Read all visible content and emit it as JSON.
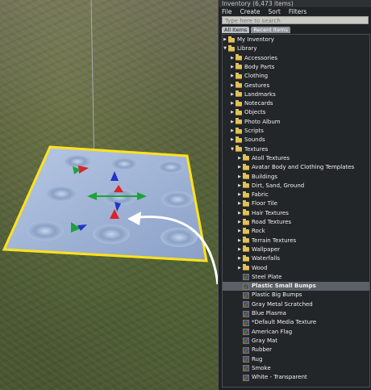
{
  "panel": {
    "title": "Inventory (6,473 items)",
    "menu": [
      "File",
      "Create",
      "Sort",
      "Filters"
    ],
    "search_placeholder": "Type here to search",
    "tabs": [
      "All Items",
      "Recent Items"
    ]
  },
  "tree": [
    {
      "label": "My Inventory",
      "depth": 0,
      "kind": "folder",
      "expanded": false
    },
    {
      "label": "Library",
      "depth": 0,
      "kind": "folder",
      "expanded": true
    },
    {
      "label": "Accessories",
      "depth": 1,
      "kind": "folder",
      "expanded": false
    },
    {
      "label": "Body Parts",
      "depth": 1,
      "kind": "folder",
      "expanded": false
    },
    {
      "label": "Clothing",
      "depth": 1,
      "kind": "folder",
      "expanded": false
    },
    {
      "label": "Gestures",
      "depth": 1,
      "kind": "folder",
      "expanded": false
    },
    {
      "label": "Landmarks",
      "depth": 1,
      "kind": "folder",
      "expanded": false
    },
    {
      "label": "Notecards",
      "depth": 1,
      "kind": "folder",
      "expanded": false
    },
    {
      "label": "Objects",
      "depth": 1,
      "kind": "folder",
      "expanded": false
    },
    {
      "label": "Photo Album",
      "depth": 1,
      "kind": "folder",
      "expanded": false
    },
    {
      "label": "Scripts",
      "depth": 1,
      "kind": "folder",
      "expanded": false
    },
    {
      "label": "Sounds",
      "depth": 1,
      "kind": "folder",
      "expanded": false
    },
    {
      "label": "Textures",
      "depth": 1,
      "kind": "folder",
      "expanded": true
    },
    {
      "label": "Atoll Textures",
      "depth": 2,
      "kind": "folder",
      "expanded": false
    },
    {
      "label": "Avatar Body and Clothing Templates",
      "depth": 2,
      "kind": "folder",
      "expanded": false
    },
    {
      "label": "Buildings",
      "depth": 2,
      "kind": "folder",
      "expanded": false
    },
    {
      "label": "Dirt, Sand, Ground",
      "depth": 2,
      "kind": "folder",
      "expanded": false
    },
    {
      "label": "Fabric",
      "depth": 2,
      "kind": "folder",
      "expanded": false
    },
    {
      "label": "Floor Tile",
      "depth": 2,
      "kind": "folder",
      "expanded": false
    },
    {
      "label": "Hair Textures",
      "depth": 2,
      "kind": "folder",
      "expanded": false
    },
    {
      "label": "Road Textures",
      "depth": 2,
      "kind": "folder",
      "expanded": false
    },
    {
      "label": "Rock",
      "depth": 2,
      "kind": "folder",
      "expanded": false
    },
    {
      "label": "Terrain Textures",
      "depth": 2,
      "kind": "folder",
      "expanded": false
    },
    {
      "label": "Wallpaper",
      "depth": 2,
      "kind": "folder",
      "expanded": false
    },
    {
      "label": "Waterfalls",
      "depth": 2,
      "kind": "folder",
      "expanded": false
    },
    {
      "label": "Wood",
      "depth": 2,
      "kind": "folder",
      "expanded": false
    },
    {
      "label": "Steel Plate",
      "depth": 2,
      "kind": "texture"
    },
    {
      "label": "Plastic Small Bumps",
      "depth": 2,
      "kind": "texture",
      "selected": true
    },
    {
      "label": "Plastic Big Bumps",
      "depth": 2,
      "kind": "texture"
    },
    {
      "label": "Gray Metal Scratched",
      "depth": 2,
      "kind": "texture"
    },
    {
      "label": "Blue Plasma",
      "depth": 2,
      "kind": "texture"
    },
    {
      "label": "*Default Media Texture",
      "depth": 2,
      "kind": "texture"
    },
    {
      "label": "American Flag",
      "depth": 2,
      "kind": "texture"
    },
    {
      "label": "Gray Mat",
      "depth": 2,
      "kind": "texture"
    },
    {
      "label": "Rubber",
      "depth": 2,
      "kind": "texture"
    },
    {
      "label": "Rug",
      "depth": 2,
      "kind": "texture"
    },
    {
      "label": "Smoke",
      "depth": 2,
      "kind": "texture"
    },
    {
      "label": "White - Transparent",
      "depth": 2,
      "kind": "texture"
    }
  ],
  "colors": {
    "selection_outline": "#ffe21a",
    "prim_surface": "#9fb5d8",
    "folder": "#e0c25a"
  }
}
